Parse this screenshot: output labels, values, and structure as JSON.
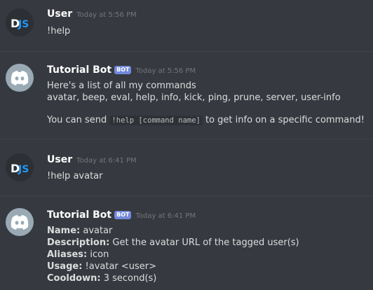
{
  "messages": [
    {
      "author": "User",
      "time": "Today at 5:56 PM",
      "text": "!help"
    },
    {
      "author": "Tutorial Bot",
      "badge": "BOT",
      "time": "Today at 5:56 PM",
      "line1": "Here's a list of all my commands",
      "line2": "avatar, beep, eval, help, info, kick, ping, prune, server, user-info",
      "send_pre": "You can send ",
      "send_code": "!help [command name]",
      "send_post": " to get info on a specific command!"
    },
    {
      "author": "User",
      "time": "Today at 6:41 PM",
      "text": "!help avatar"
    },
    {
      "author": "Tutorial Bot",
      "badge": "BOT",
      "time": "Today at 6:41 PM",
      "fields": [
        {
          "key": "Name:",
          "value": " avatar"
        },
        {
          "key": "Description:",
          "value": " Get the avatar URL of the tagged user(s)"
        },
        {
          "key": "Aliases:",
          "value": " icon"
        },
        {
          "key": "Usage:",
          "value": " !avatar <user>"
        },
        {
          "key": "Cooldown:",
          "value": " 3 second(s)"
        }
      ]
    }
  ],
  "logo_text": "DJS",
  "icons": {
    "user_avatar": "djs-logo-icon",
    "bot_avatar": "discord-logo-icon"
  },
  "colors": {
    "background": "#36393f",
    "badge": "#7289da",
    "bot_avatar": "#99aab5",
    "timestamp": "#72767d"
  }
}
